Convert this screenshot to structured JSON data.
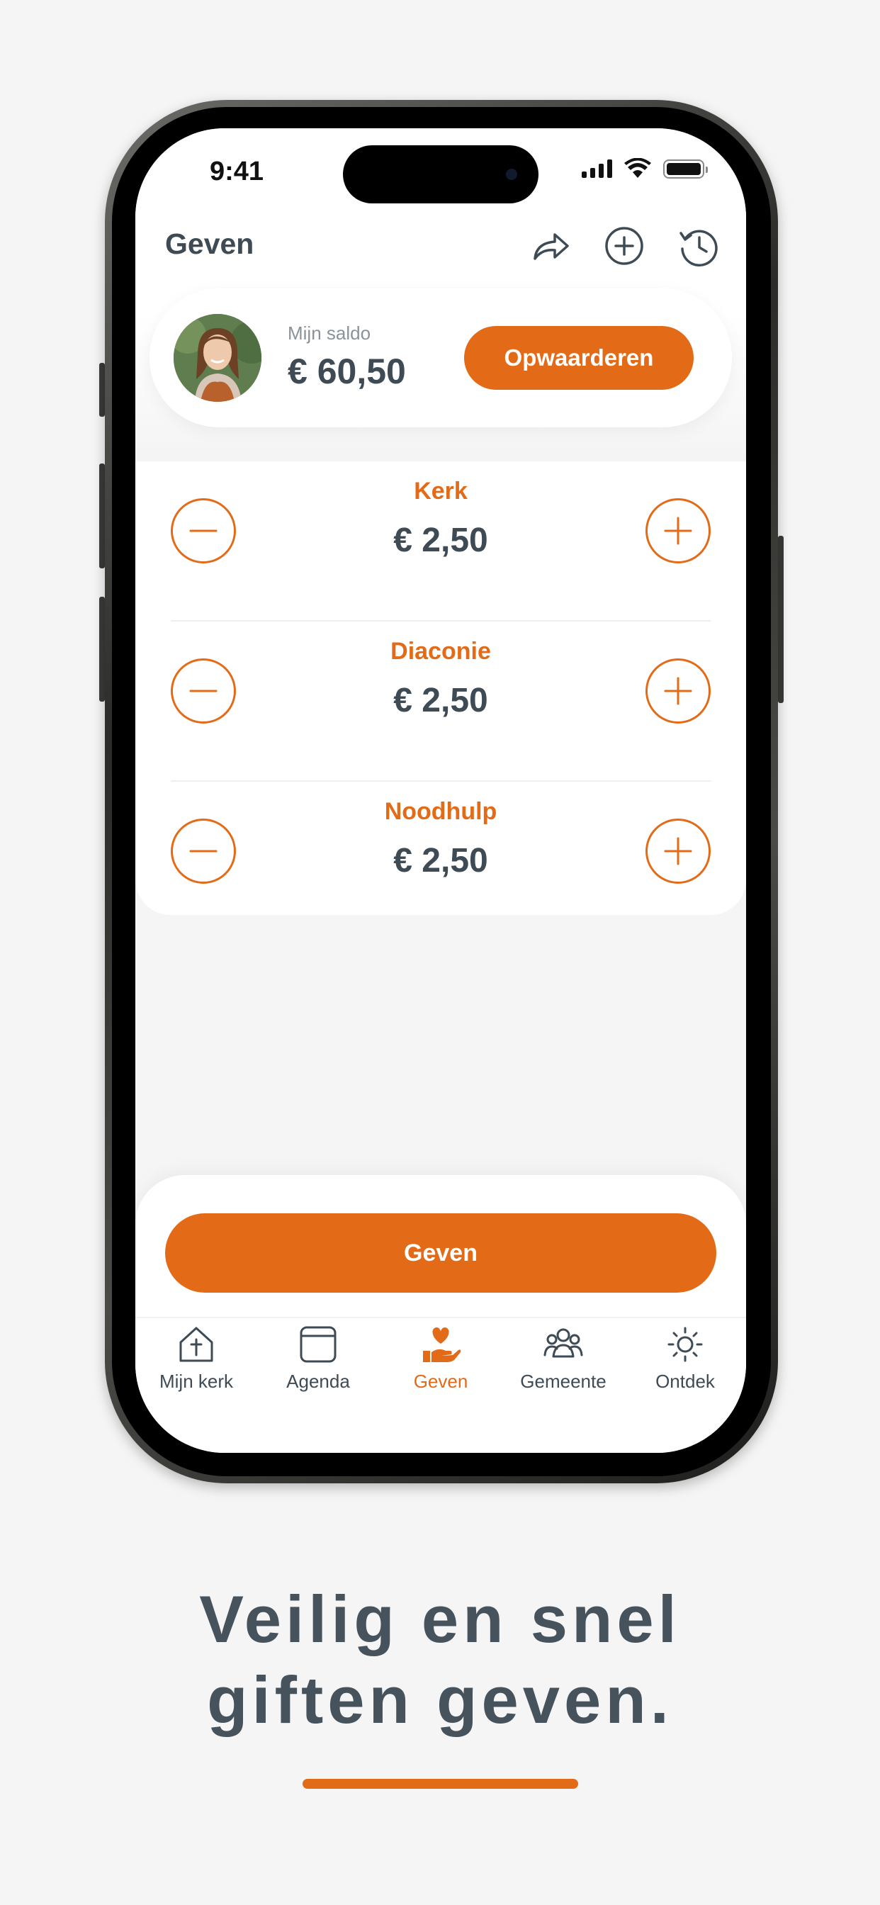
{
  "status_bar": {
    "time": "9:41"
  },
  "header": {
    "title": "Geven",
    "icons": [
      "share-icon",
      "plus-circle-icon",
      "history-icon"
    ]
  },
  "balance": {
    "label": "Mijn saldo",
    "amount": "€ 60,50",
    "topup_label": "Opwaarderen"
  },
  "donations": [
    {
      "name": "Kerk",
      "amount": "€ 2,50"
    },
    {
      "name": "Diaconie",
      "amount": "€ 2,50"
    },
    {
      "name": "Noodhulp",
      "amount": "€ 2,50"
    }
  ],
  "give_button": {
    "label": "Geven"
  },
  "tabbar": {
    "items": [
      {
        "label": "Mijn kerk",
        "icon": "church-icon",
        "active": false
      },
      {
        "label": "Agenda",
        "icon": "calendar-icon",
        "active": false
      },
      {
        "label": "Geven",
        "icon": "giving-hand-icon",
        "active": true
      },
      {
        "label": "Gemeente",
        "icon": "community-icon",
        "active": false
      },
      {
        "label": "Ontdek",
        "icon": "discover-icon",
        "active": false
      }
    ]
  },
  "tagline": {
    "line1": "Veilig en snel",
    "line2": "giften geven."
  },
  "colors": {
    "accent": "#e36b18",
    "text": "#3e4b55",
    "background": "#f5f5f5"
  }
}
